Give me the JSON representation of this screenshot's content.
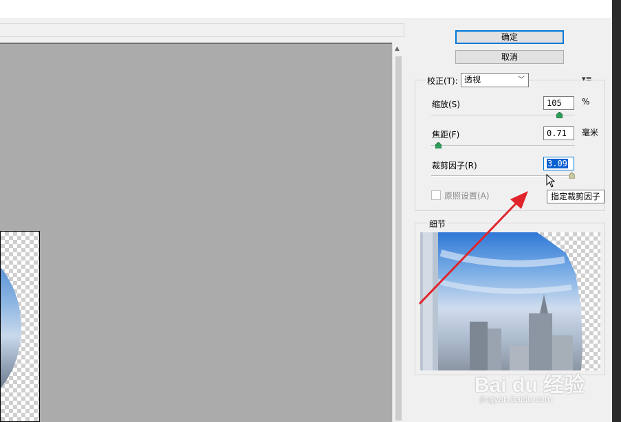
{
  "dialog": {
    "ok_label": "确定",
    "cancel_label": "取消",
    "correction_label": "校正(T):",
    "correction_value": "透视",
    "menu_icon": "flyout-menu-icon",
    "controls": [
      {
        "label": "缩放(S)",
        "value": "105",
        "unit": "%",
        "slider_fraction": 0.89
      },
      {
        "label": "焦距(F)",
        "value": "0.71",
        "unit": "毫米",
        "slider_fraction": 0.05
      },
      {
        "label": "裁剪因子(R)",
        "value": "3.09",
        "unit": "",
        "slider_fraction": 0.98
      }
    ],
    "as_shot_label": "原照设置(A)",
    "as_shot_checked": false,
    "tooltip": "指定裁剪因子",
    "detail_label": "细节"
  },
  "watermark": {
    "logo": "Bai du 经验",
    "url": "jingyan.baidu.com"
  },
  "colors": {
    "canvas": "#ababab",
    "focus_border": "#0078d7",
    "selection": "#0a5fd1",
    "annotation_arrow": "#e0242b",
    "slider_thumb": "#2e9e5a"
  }
}
